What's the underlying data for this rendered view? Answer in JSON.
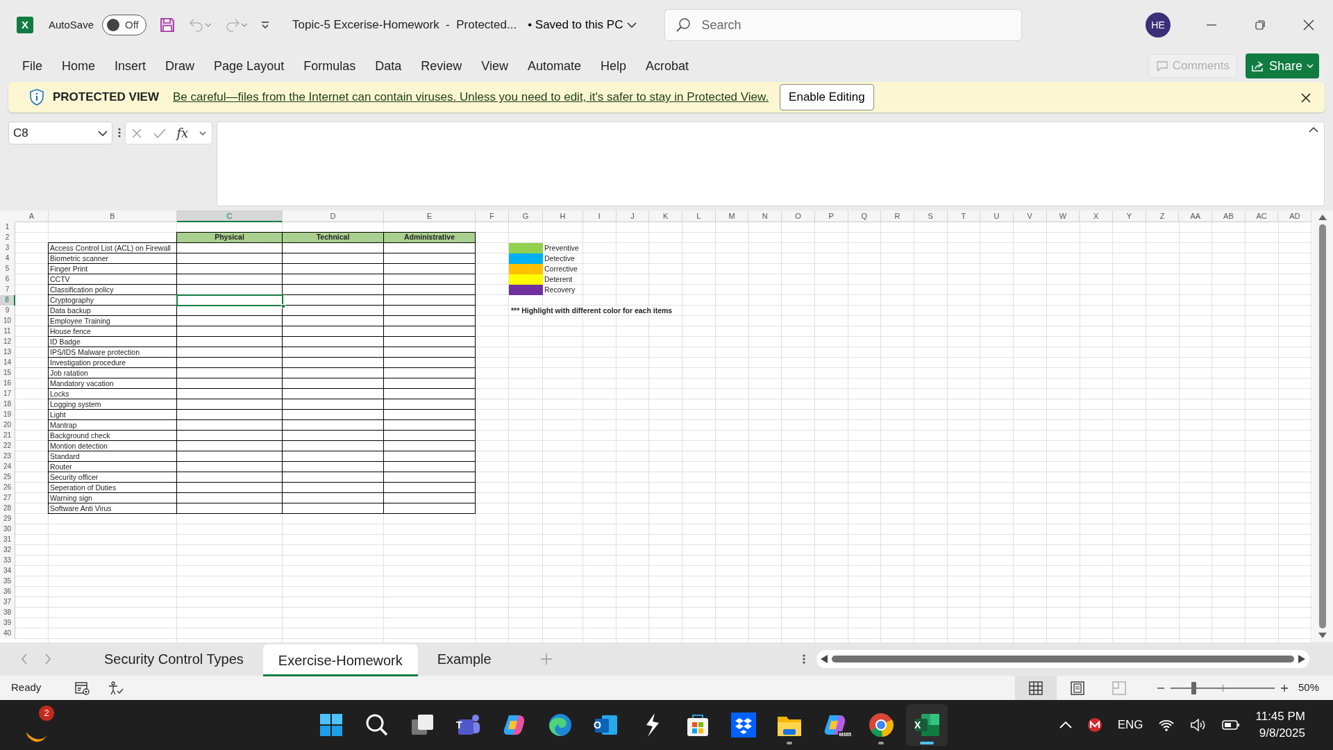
{
  "title_bar": {
    "logo_letter": "X",
    "autosave_label": "AutoSave",
    "autosave": {
      "on": false,
      "label": "Off"
    },
    "document_title": "Topic-5 Excerise-Homework  -  Protected...",
    "save_status": "• Saved to this PC",
    "search_placeholder": "Search",
    "account_initials": "HE"
  },
  "ribbon": {
    "tabs": [
      "File",
      "Home",
      "Insert",
      "Draw",
      "Page Layout",
      "Formulas",
      "Data",
      "Review",
      "View",
      "Automate",
      "Help",
      "Acrobat"
    ],
    "comments": {
      "label": "Comments",
      "disabled": true
    },
    "share": {
      "label": "Share"
    }
  },
  "protected_view": {
    "title": "PROTECTED VIEW",
    "message": "Be careful—files from the Internet can contain viruses. Unless you need to edit, it's safer to stay in Protected View.",
    "button": "Enable Editing"
  },
  "formula_bar": {
    "name_box": "C8",
    "function_label": "fx"
  },
  "sheet": {
    "columns": [
      {
        "label": "A",
        "selected": false
      },
      {
        "label": "B",
        "selected": false
      },
      {
        "label": "C",
        "selected": true
      },
      {
        "label": "D",
        "selected": false
      },
      {
        "label": "E",
        "selected": false
      },
      {
        "label": "F",
        "selected": false
      },
      {
        "label": "G",
        "selected": false
      },
      {
        "label": "H",
        "selected": false
      },
      {
        "label": "I",
        "selected": false
      },
      {
        "label": "J",
        "selected": false
      },
      {
        "label": "K",
        "selected": false
      },
      {
        "label": "L",
        "selected": false
      },
      {
        "label": "M",
        "selected": false
      },
      {
        "label": "N",
        "selected": false
      },
      {
        "label": "O",
        "selected": false
      },
      {
        "label": "P",
        "selected": false
      },
      {
        "label": "Q",
        "selected": false
      },
      {
        "label": "R",
        "selected": false
      },
      {
        "label": "S",
        "selected": false
      },
      {
        "label": "T",
        "selected": false
      },
      {
        "label": "U",
        "selected": false
      },
      {
        "label": "V",
        "selected": false
      },
      {
        "label": "W",
        "selected": false
      },
      {
        "label": "X",
        "selected": false
      },
      {
        "label": "Y",
        "selected": false
      },
      {
        "label": "Z",
        "selected": false
      },
      {
        "label": "AA",
        "selected": false
      },
      {
        "label": "AB",
        "selected": false
      },
      {
        "label": "AC",
        "selected": false
      },
      {
        "label": "AD",
        "selected": false
      }
    ],
    "rows": [
      {
        "label": "1",
        "selected": false
      },
      {
        "label": "2",
        "selected": false
      },
      {
        "label": "3",
        "selected": false
      },
      {
        "label": "4",
        "selected": false
      },
      {
        "label": "5",
        "selected": false
      },
      {
        "label": "6",
        "selected": false
      },
      {
        "label": "7",
        "selected": false
      },
      {
        "label": "8",
        "selected": true
      },
      {
        "label": "9",
        "selected": false
      },
      {
        "label": "10",
        "selected": false
      },
      {
        "label": "11",
        "selected": false
      },
      {
        "label": "12",
        "selected": false
      },
      {
        "label": "13",
        "selected": false
      },
      {
        "label": "14",
        "selected": false
      },
      {
        "label": "15",
        "selected": false
      },
      {
        "label": "16",
        "selected": false
      },
      {
        "label": "17",
        "selected": false
      },
      {
        "label": "18",
        "selected": false
      },
      {
        "label": "19",
        "selected": false
      },
      {
        "label": "20",
        "selected": false
      },
      {
        "label": "21",
        "selected": false
      },
      {
        "label": "22",
        "selected": false
      },
      {
        "label": "23",
        "selected": false
      },
      {
        "label": "24",
        "selected": false
      },
      {
        "label": "25",
        "selected": false
      },
      {
        "label": "26",
        "selected": false
      },
      {
        "label": "27",
        "selected": false
      },
      {
        "label": "28",
        "selected": false
      },
      {
        "label": "29",
        "selected": false
      },
      {
        "label": "30",
        "selected": false
      },
      {
        "label": "31",
        "selected": false
      },
      {
        "label": "32",
        "selected": false
      },
      {
        "label": "33",
        "selected": false
      },
      {
        "label": "34",
        "selected": false
      },
      {
        "label": "35",
        "selected": false
      },
      {
        "label": "36",
        "selected": false
      },
      {
        "label": "37",
        "selected": false
      },
      {
        "label": "38",
        "selected": false
      },
      {
        "label": "39",
        "selected": false
      },
      {
        "label": "40",
        "selected": false
      }
    ],
    "table": {
      "headers": [
        "Physical",
        "Technical",
        "Administrative"
      ],
      "items": [
        "Access Control List (ACL) on Firewall",
        "Biometric scanner",
        "Finger Print",
        "CCTV",
        "Classification policy",
        "Cryptography",
        "Data backup",
        "Employee Training",
        "House fence",
        "ID Badge",
        "IPS/IDS Malware protection",
        "Investigation procedure",
        "Job ratation",
        "Mandatory vacation",
        "Locks",
        "Logging system",
        "Light",
        "Mantrap",
        "Background check",
        "Montion detection",
        "Standard",
        "Router",
        "Security officer",
        "Seperation of Duties",
        "Warning sign",
        "Software Anti Virus"
      ]
    },
    "legend": [
      {
        "label": "Preventive",
        "color": "#92d050"
      },
      {
        "label": "Detective",
        "color": "#00b0f0"
      },
      {
        "label": "Corrective",
        "color": "#ffc000"
      },
      {
        "label": "Deterent",
        "color": "#ffff00"
      },
      {
        "label": "Recovery",
        "color": "#7030a0"
      }
    ],
    "note": "*** Highlight with different color for each items"
  },
  "sheet_tabs": [
    {
      "label": "Security Control Types",
      "selected": false
    },
    {
      "label": "Exercise-Homework",
      "selected": true
    },
    {
      "label": "Example",
      "selected": false
    }
  ],
  "status_bar": {
    "status": "Ready",
    "views": [
      {
        "kind": "normal",
        "selected": true
      },
      {
        "kind": "page-layout",
        "selected": false
      },
      {
        "kind": "page-break",
        "selected": false
      }
    ],
    "zoom": {
      "level": 0.22,
      "reading": "50%"
    }
  },
  "taskbar": {
    "widget_badge": "2",
    "apps": [
      {
        "kind": "start",
        "running": false,
        "selected": false
      },
      {
        "kind": "search",
        "running": false,
        "selected": false
      },
      {
        "kind": "task-view",
        "running": false,
        "selected": false
      },
      {
        "kind": "teams",
        "glyph": "T",
        "running": false,
        "selected": false
      },
      {
        "kind": "copilot",
        "running": false,
        "selected": false
      },
      {
        "kind": "edge",
        "running": false,
        "selected": false
      },
      {
        "kind": "outlook",
        "glyph": "O",
        "running": false,
        "selected": false
      },
      {
        "kind": "bolt",
        "running": false,
        "selected": false
      },
      {
        "kind": "store",
        "running": false,
        "selected": false
      },
      {
        "kind": "dropbox",
        "running": false,
        "selected": false
      },
      {
        "kind": "explorer",
        "running": true,
        "selected": false
      },
      {
        "kind": "m365",
        "glyph": "M365",
        "running": false,
        "selected": false
      },
      {
        "kind": "chrome",
        "running": true,
        "selected": false
      },
      {
        "kind": "excel",
        "glyph": "X",
        "running": true,
        "selected": true
      }
    ],
    "language": "ENG",
    "time": "11:45 PM",
    "date": "9/8/2025"
  }
}
